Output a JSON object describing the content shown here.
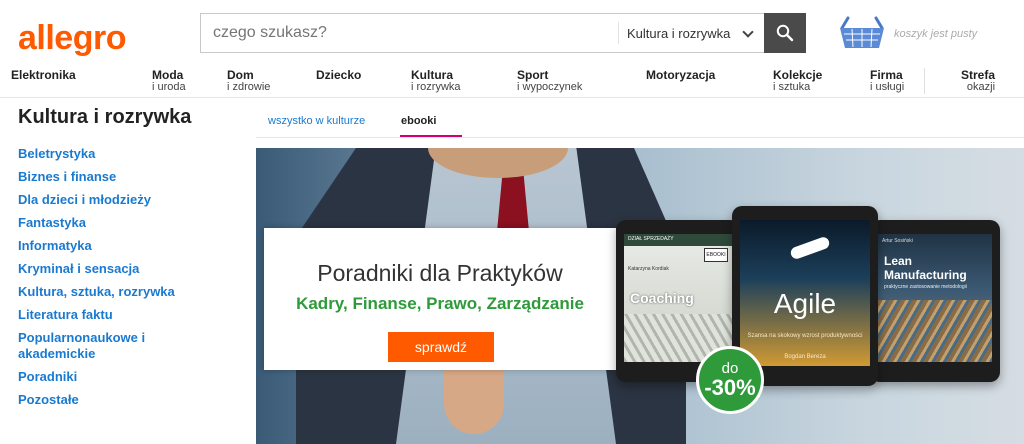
{
  "header": {
    "logo": "allegro",
    "search": {
      "placeholder": "czego szukasz?",
      "category": "Kultura i rozrywka"
    },
    "cart_text": "koszyk jest pusty"
  },
  "nav": [
    {
      "main": "Elektronika",
      "sub": ""
    },
    {
      "main": "Moda",
      "sub": "i uroda"
    },
    {
      "main": "Dom",
      "sub": "i zdrowie"
    },
    {
      "main": "Dziecko",
      "sub": ""
    },
    {
      "main": "Kultura",
      "sub": "i rozrywka"
    },
    {
      "main": "Sport",
      "sub": "i wypoczynek"
    },
    {
      "main": "Motoryzacja",
      "sub": ""
    },
    {
      "main": "Kolekcje",
      "sub": "i sztuka"
    },
    {
      "main": "Firma",
      "sub": "i usługi"
    },
    {
      "main": "Strefa",
      "sub": "okazji"
    }
  ],
  "page": {
    "title": "Kultura i rozrywka",
    "tabs": [
      {
        "label": "wszystko w kulturze",
        "active": false
      },
      {
        "label": "ebooki",
        "active": true
      }
    ]
  },
  "sidebar": {
    "items": [
      "Beletrystyka",
      "Biznes i finanse",
      "Dla dzieci i młodzieży",
      "Fantastyka",
      "Informatyka",
      "Kryminał i sensacja",
      "Kultura, sztuka, rozrywka",
      "Literatura faktu",
      "Popularnonaukowe i akademickie",
      "Poradniki",
      "Pozostałe"
    ]
  },
  "banner": {
    "title": "Poradniki dla Praktyków",
    "subtitle": "Kadry, Finanse, Prawo, Zarządzanie",
    "button": "sprawdź",
    "badge_top": "do",
    "badge_main": "-30%",
    "books": [
      {
        "tag": "DZIAŁ SPRZEDAŻY",
        "box": "EBOOKI",
        "author": "Katarzyna Kordiak",
        "title": "Coaching"
      },
      {
        "title": "Agile",
        "subtitle": "Szansa na skokowy wzrost produktywności",
        "author": "Bogdan Bereza"
      },
      {
        "author": "Artur Sosiński",
        "title": "Lean Manufacturing",
        "subtitle": "praktyczne zastosowanie metodologii"
      }
    ]
  },
  "colors": {
    "brand": "#ff5a00",
    "link": "#1a7ad0",
    "tab_accent": "#d4006b",
    "promo_green": "#2e9a3a"
  }
}
